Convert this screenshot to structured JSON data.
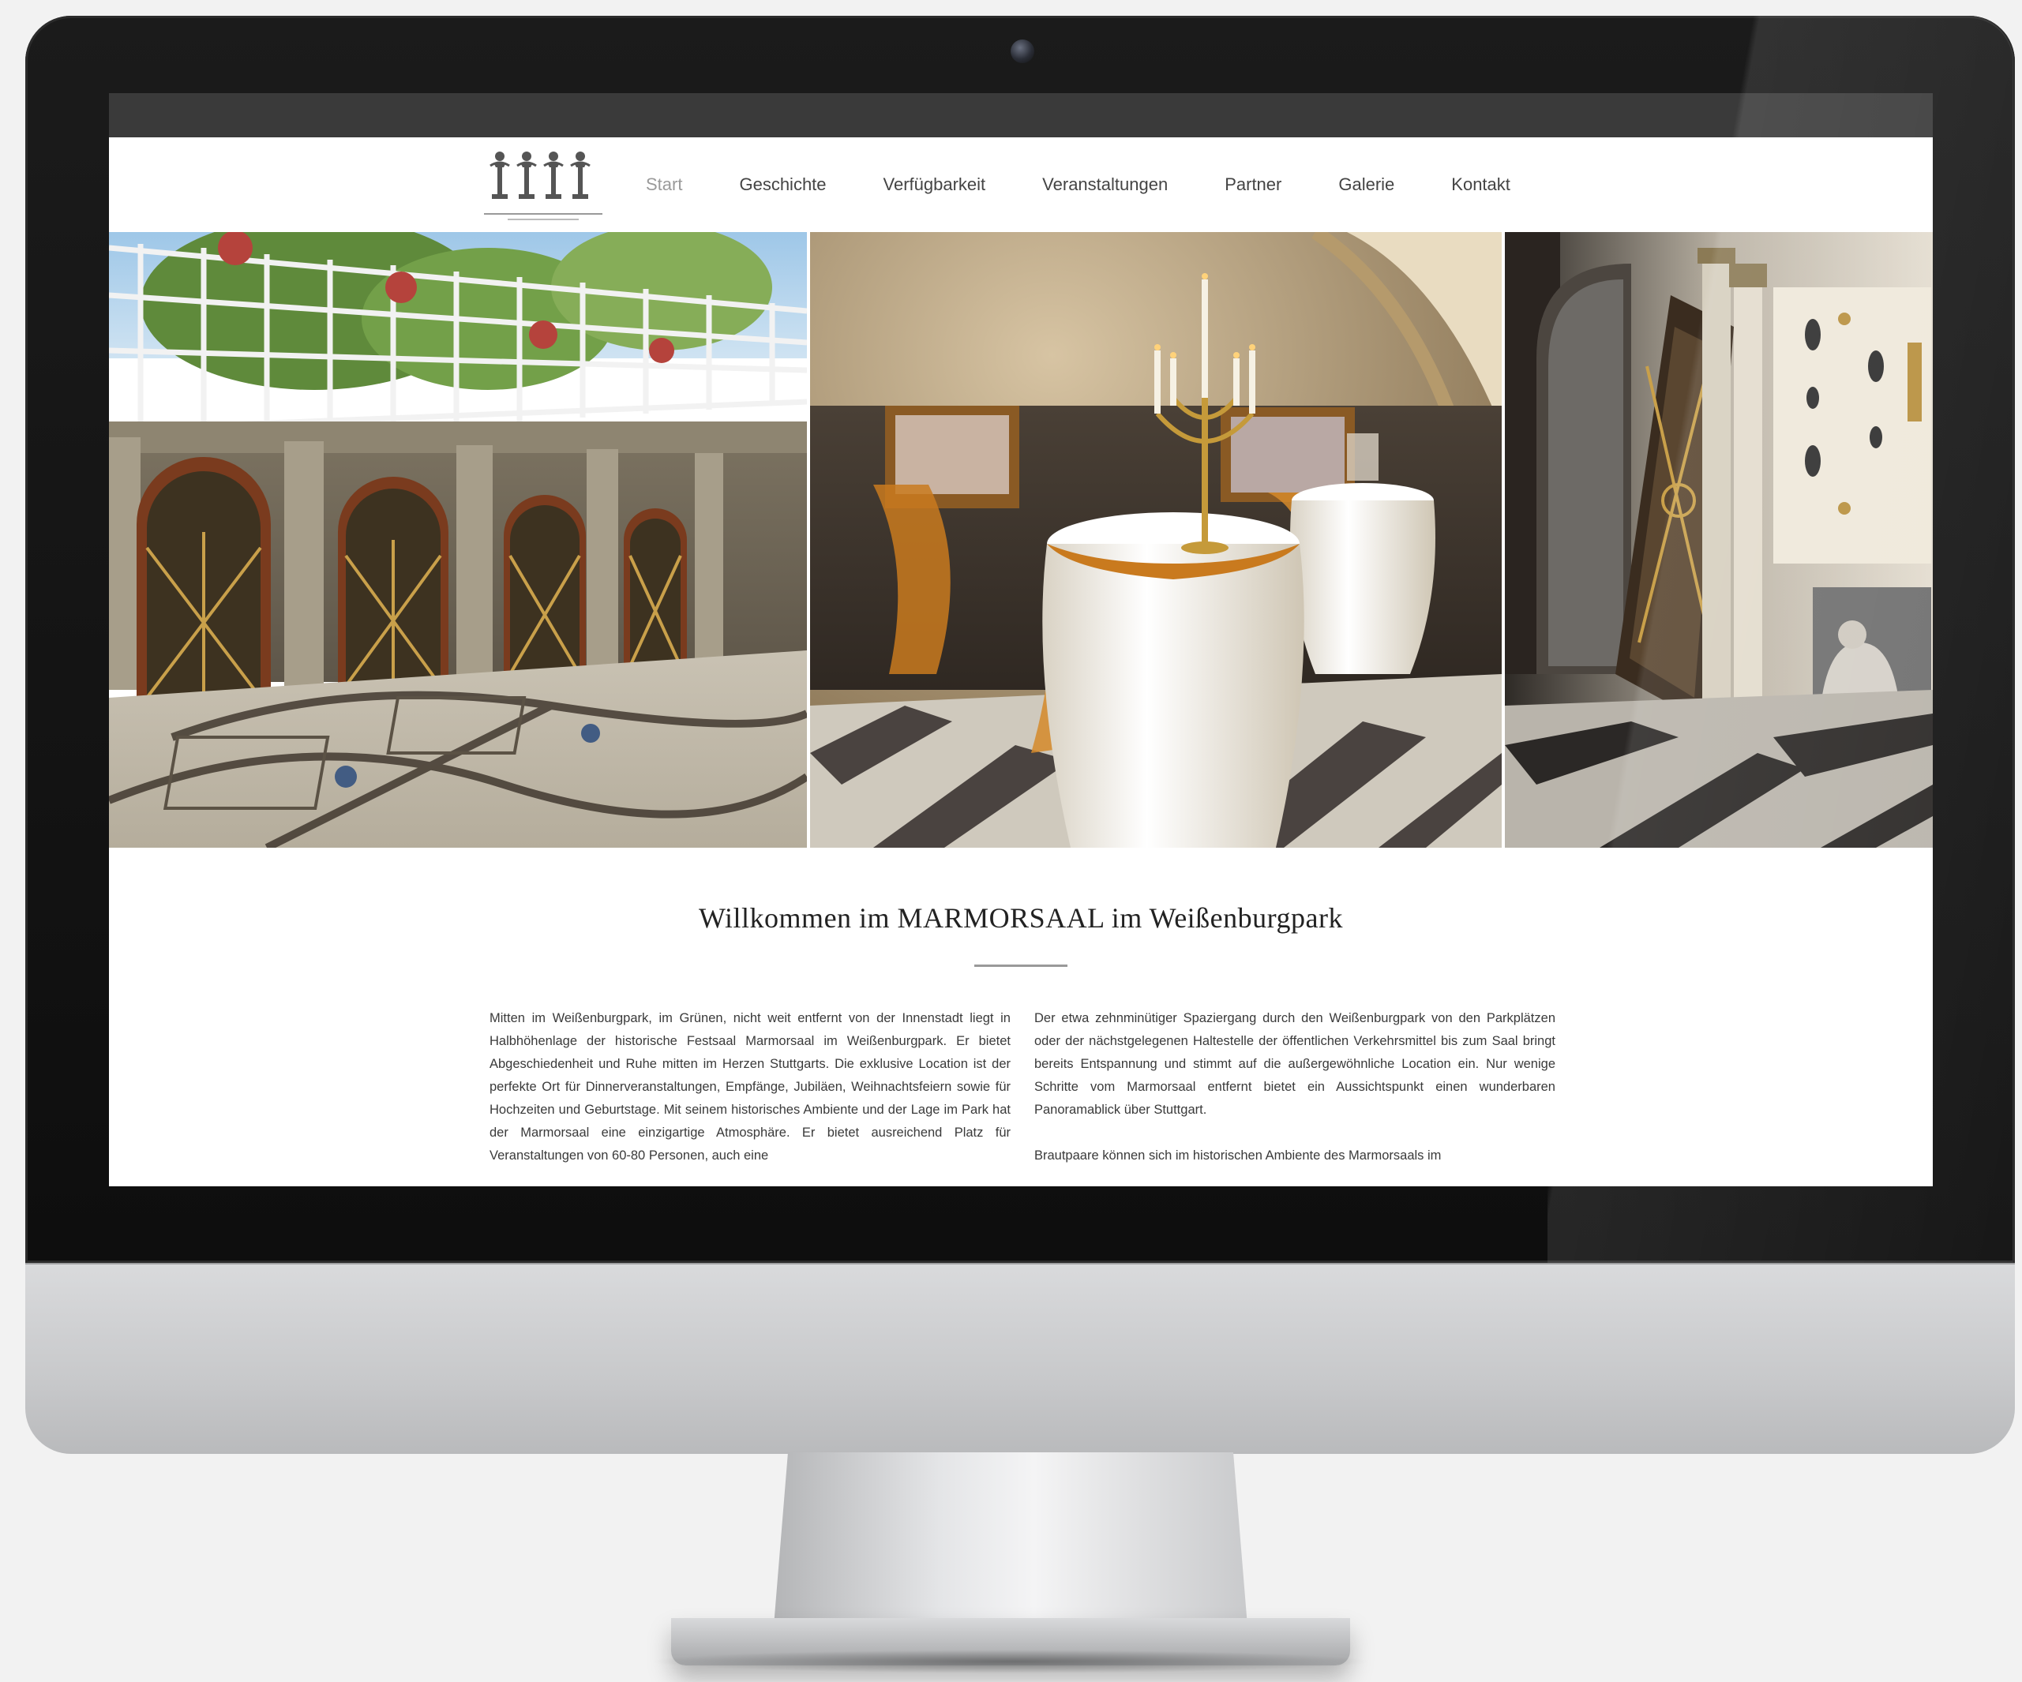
{
  "nav": {
    "items": [
      "Start",
      "Geschichte",
      "Verfügbarkeit",
      "Veranstaltungen",
      "Partner",
      "Galerie",
      "Kontakt"
    ],
    "active": "Start"
  },
  "hero": {
    "images": [
      {
        "name": "exterior-terrace-photo"
      },
      {
        "name": "candelabra-tables-photo"
      },
      {
        "name": "marble-hall-doorway-photo"
      }
    ]
  },
  "main": {
    "title": "Willkommen im MARMORSAAL im Weißenburgpark",
    "col_left": [
      "Mitten im Weißenburgpark, im Grünen, nicht weit entfernt von der Innenstadt liegt in Halbhöhenlage der historische Festsaal Marmorsaal im Weißenburgpark. Er bietet Abgeschiedenheit und Ruhe mitten im Herzen Stuttgarts. Die exklusive Location ist der perfekte Ort für Dinnerveranstaltungen, Empfänge, Jubiläen, Weihnachtsfeiern sowie für Hochzeiten und Geburtstage. Mit seinem historisches Ambiente und der Lage im Park hat der Marmorsaal eine einzigartige Atmosphäre. Er bietet ausreichend Platz für Veranstaltungen von 60-80 Personen, auch eine"
    ],
    "col_right": [
      "Der etwa zehnminütiger Spaziergang durch den Weißenburgpark von den Parkplätzen oder der nächstgelegenen Haltestelle der öffentlichen Verkehrsmittel bis zum Saal bringt bereits Entspannung und stimmt auf die außergewöhnliche Location ein. Nur wenige Schritte vom Marmorsaal entfernt bietet ein Aussichtspunkt einen wunderbaren Panoramablick über Stuttgart.",
      "Brautpaare können sich im historischen Ambiente des Marmorsaals im"
    ]
  }
}
